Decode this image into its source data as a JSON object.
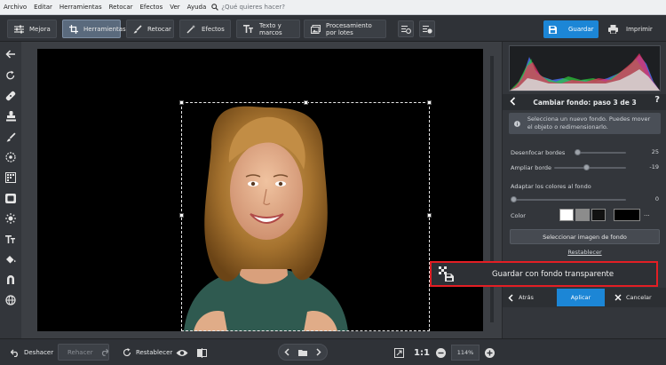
{
  "menu": {
    "items": [
      "Archivo",
      "Editar",
      "Herramientas",
      "Retocar",
      "Efectos",
      "Ver",
      "Ayuda"
    ],
    "search_placeholder": "¿Qué quieres hacer?"
  },
  "tabs": [
    {
      "label": "Mejora",
      "icon": "sliders-icon"
    },
    {
      "label": "Herramientas",
      "icon": "crop-icon",
      "active": true
    },
    {
      "label": "Retocar",
      "icon": "brush-icon"
    },
    {
      "label": "Efectos",
      "icon": "magic-wand-icon"
    },
    {
      "label": "Texto y marcos",
      "icon": "text-icon"
    },
    {
      "label": "Procesamiento por lotes",
      "icon": "batch-icon"
    }
  ],
  "toolbar": {
    "save_label": "Guardar",
    "print_label": "Imprimir"
  },
  "panel": {
    "step_title": "Cambiar fondo: paso 3 de 3",
    "help": "?",
    "info_text": "Selecciona un nuevo fondo. Puedes mover el objeto o redimensionarlo.",
    "sliders": [
      {
        "label": "Desenfocar bordes",
        "value": 25
      },
      {
        "label": "Ampliar borde",
        "value": -19
      }
    ],
    "adapt_label": "Adaptar los colores al fondo",
    "adapt_value": 0,
    "color_label": "Color",
    "swatch_colors": [
      "#ffffff",
      "#8c8c8c",
      "#111111",
      "#000000"
    ],
    "more_label": "...",
    "select_bg_button": "Seleccionar imagen de fondo",
    "reset_link": "Restablecer",
    "back_label": "Atrás",
    "apply_label": "Aplicar",
    "cancel_label": "Cancelar"
  },
  "callout": {
    "label": "Guardar con fondo transparente",
    "border_color": "#e31e24"
  },
  "bottom": {
    "undo_label": "Deshacer",
    "redo_label": "Rehacer",
    "reset_label": "Restablecer",
    "ratio_label": "1:1",
    "zoom_value": "114%"
  },
  "colors": {
    "accent": "#1c86d6",
    "highlight": "#e31e24"
  }
}
